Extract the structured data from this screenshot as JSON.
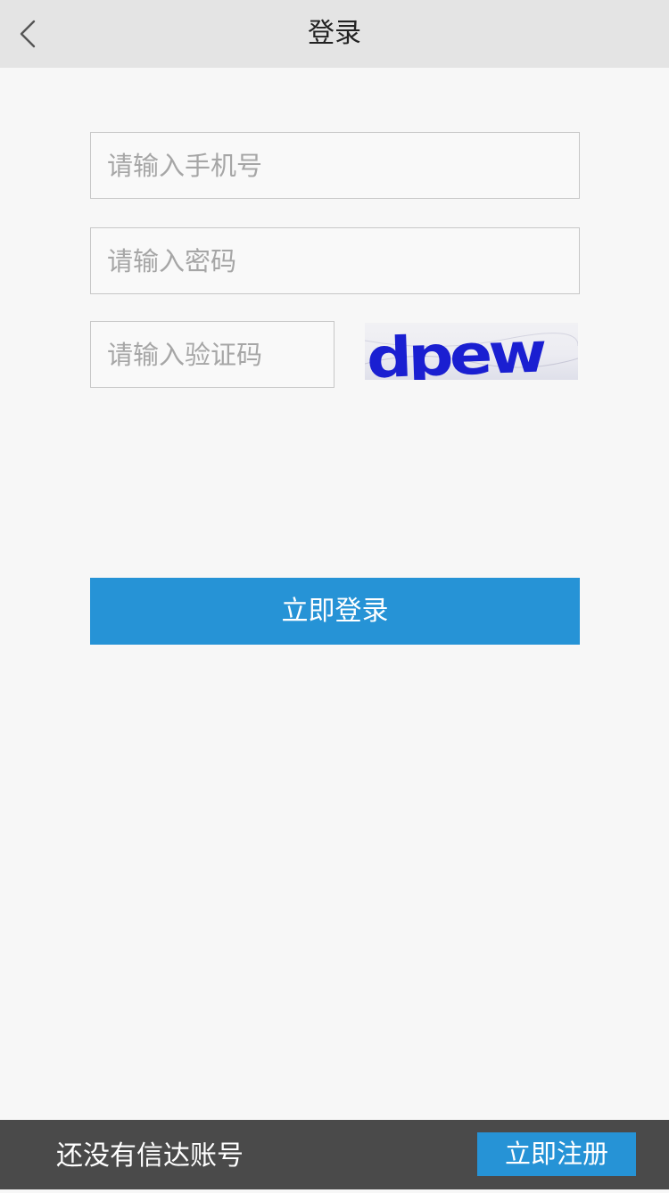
{
  "header": {
    "title": "登录",
    "back_icon": "chevron-left-icon"
  },
  "form": {
    "phone_placeholder": "请输入手机号",
    "phone_value": "",
    "password_placeholder": "请输入密码",
    "password_value": "",
    "captcha_placeholder": "请输入验证码",
    "captcha_value": "",
    "captcha_image_text": "dpew",
    "login_label": "立即登录"
  },
  "footer": {
    "prompt": "还没有信达账号",
    "register_label": "立即注册"
  },
  "colors": {
    "accent": "#2693d6",
    "header_bg": "#e4e4e4",
    "footer_bg": "#4a4a4a",
    "page_bg": "#f7f7f7",
    "captcha_text": "#1a1fd1"
  }
}
